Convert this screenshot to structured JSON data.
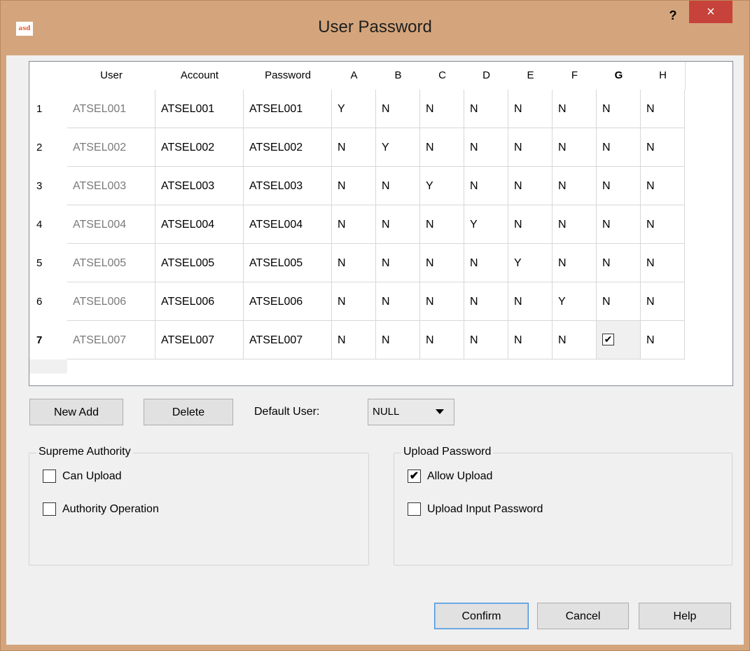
{
  "window": {
    "title": "User Password",
    "app_icon_text": "asd",
    "help_label": "?",
    "close_label": "×"
  },
  "table": {
    "columns": [
      "User",
      "Account",
      "Password",
      "A",
      "B",
      "C",
      "D",
      "E",
      "F",
      "G",
      "H"
    ],
    "rows": [
      {
        "num": "1",
        "user": "ATSEL001",
        "account": "ATSEL001",
        "password": "ATSEL001",
        "flags": [
          "Y",
          "N",
          "N",
          "N",
          "N",
          "N",
          "N",
          "N"
        ]
      },
      {
        "num": "2",
        "user": "ATSEL002",
        "account": "ATSEL002",
        "password": "ATSEL002",
        "flags": [
          "N",
          "Y",
          "N",
          "N",
          "N",
          "N",
          "N",
          "N"
        ]
      },
      {
        "num": "3",
        "user": "ATSEL003",
        "account": "ATSEL003",
        "password": "ATSEL003",
        "flags": [
          "N",
          "N",
          "Y",
          "N",
          "N",
          "N",
          "N",
          "N"
        ]
      },
      {
        "num": "4",
        "user": "ATSEL004",
        "account": "ATSEL004",
        "password": "ATSEL004",
        "flags": [
          "N",
          "N",
          "N",
          "Y",
          "N",
          "N",
          "N",
          "N"
        ]
      },
      {
        "num": "5",
        "user": "ATSEL005",
        "account": "ATSEL005",
        "password": "ATSEL005",
        "flags": [
          "N",
          "N",
          "N",
          "N",
          "Y",
          "N",
          "N",
          "N"
        ]
      },
      {
        "num": "6",
        "user": "ATSEL006",
        "account": "ATSEL006",
        "password": "ATSEL006",
        "flags": [
          "N",
          "N",
          "N",
          "N",
          "N",
          "Y",
          "N",
          "N"
        ]
      },
      {
        "num": "7",
        "user": "ATSEL007",
        "account": "ATSEL007",
        "password": "ATSEL007",
        "flags": [
          "N",
          "N",
          "N",
          "N",
          "N",
          "N",
          "checked",
          "N"
        ]
      }
    ]
  },
  "controls": {
    "new_add_label": "New Add",
    "delete_label": "Delete",
    "default_user_label": "Default User:",
    "default_user_value": "NULL"
  },
  "supreme_authority": {
    "title": "Supreme Authority",
    "can_upload": {
      "label": "Can Upload",
      "checked": false
    },
    "authority_operation": {
      "label": "Authority Operation",
      "checked": false
    }
  },
  "upload_password": {
    "title": "Upload Password",
    "allow_upload": {
      "label": "Allow Upload",
      "checked": true
    },
    "upload_input_password": {
      "label": "Upload Input Password",
      "checked": false
    }
  },
  "footer": {
    "confirm_label": "Confirm",
    "cancel_label": "Cancel",
    "help_label": "Help"
  }
}
